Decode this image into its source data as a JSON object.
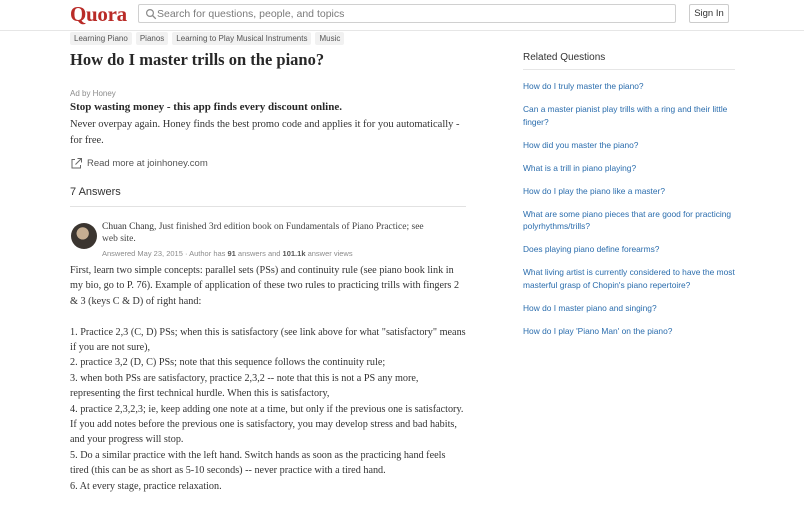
{
  "header": {
    "logo": "Quora",
    "search_placeholder": "Search for questions, people, and topics",
    "signin_label": "Sign In"
  },
  "topics": [
    "Learning Piano",
    "Pianos",
    "Learning to Play Musical Instruments",
    "Music"
  ],
  "question": {
    "title": "How do I master trills on the piano?"
  },
  "ad": {
    "label": "Ad by Honey",
    "headline": "Stop wasting money - this app finds every discount online.",
    "body": "Never overpay again. Honey finds the best promo code and applies it for you automatically - for free.",
    "link_text": "Read more at joinhoney.com"
  },
  "answers_count": "7 Answers",
  "answer": {
    "author_name": "Chuan Chang",
    "author_credential": ", Just finished 3rd edition book on Fundamentals of Piano Practice; see web site.",
    "meta_prefix": "Answered May 23, 2015 · Author has ",
    "answers_num": "91",
    "meta_mid": " answers and ",
    "views_num": "101.1k",
    "meta_suffix": " answer views",
    "paragraphs": [
      "First, learn two simple concepts: parallel sets (PSs) and continuity rule (see piano book link in my bio, go to P. 76).  Example of application of these two rules to practicing trills with fingers 2 & 3 (keys C & D) of right hand:",
      "",
      "1. Practice 2,3 (C, D) PSs; when this is satisfactory (see link above for what \"satisfactory\" means if you are not sure),",
      "2. practice 3,2 (D, C) PSs; note that this sequence follows the continuity rule;",
      "3. when both PSs are satisfactory, practice 2,3,2 -- note that this is not a PS any more, representing the first technical hurdle. When this is satisfactory,",
      "4. practice 2,3,2,3; ie, keep adding one note at a time, but only if the previous one is satisfactory.  If you add notes before the previous one is satisfactory, you may develop stress and bad habits, and your progress will stop.",
      "5. Do a similar practice with the left hand.  Switch hands as soon as the practicing hand feels tired (this can be as short as 5-10 seconds) -- never practice with a tired hand.",
      "6. At every stage, practice relaxation."
    ]
  },
  "sidebar": {
    "title": "Related Questions",
    "questions": [
      "How do I truly master the piano?",
      "Can a master pianist play trills with a ring and their little finger?",
      "How did you master the piano?",
      "What is a trill in piano playing?",
      "How do I play the piano like a master?",
      "What are some piano pieces that are good for practicing polyrhythms/trills?",
      "Does playing piano define forearms?",
      "What living artist is currently considered to have the most masterful grasp of Chopin's piano repertoire?",
      "How do I master piano and singing?",
      "How do I play 'Piano Man' on the piano?"
    ]
  },
  "colors": {
    "brand": "#b92b27",
    "link": "#2b6dad"
  },
  "icons": {
    "search": "search-icon",
    "external_link": "external-link-icon"
  }
}
